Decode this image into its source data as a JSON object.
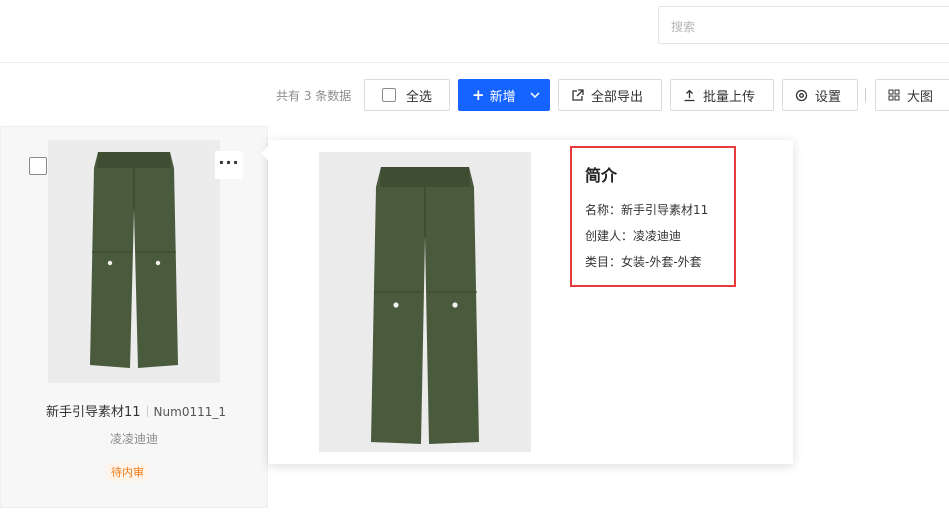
{
  "search": {
    "placeholder": "搜索"
  },
  "toolbar": {
    "count_text": "共有 3 条数据",
    "select_all": "全选",
    "add": "新增",
    "export_all": "全部导出",
    "batch_upload": "批量上传",
    "settings": "设置",
    "view_mode": "大图"
  },
  "card": {
    "name": "新手引导素材11",
    "code": "Num0111_1",
    "creator": "凌凌迪迪",
    "status": "待内审",
    "more": "···"
  },
  "popup": {
    "heading": "简介",
    "name_line": "名称：新手引导素材11",
    "creator_line": "创建人：凌凌迪迪",
    "category_line": "类目：女装-外套-外套"
  },
  "colors": {
    "primary": "#1664ff",
    "highlight_border": "#e8393b",
    "status_text": "#f07a17",
    "pants": "#4a5a3c"
  }
}
